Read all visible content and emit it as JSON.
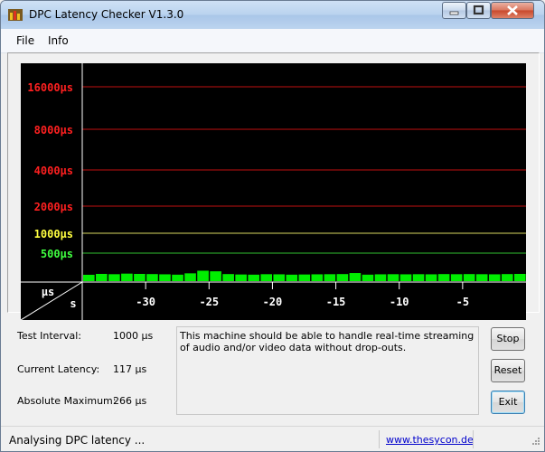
{
  "window": {
    "title": "DPC Latency Checker V1.3.0"
  },
  "menu": {
    "file": "File",
    "info": "Info"
  },
  "chart_data": {
    "type": "bar",
    "y_tick_labels": [
      {
        "label": "16000µs",
        "color": "#ff2020",
        "line_color": "#c01010"
      },
      {
        "label": "8000µs",
        "color": "#ff2020",
        "line_color": "#c01010"
      },
      {
        "label": "4000µs",
        "color": "#ff2020",
        "line_color": "#c01010"
      },
      {
        "label": "2000µs",
        "color": "#ff2020",
        "line_color": "#c01010"
      },
      {
        "label": "1000µs",
        "color": "#ffff40",
        "line_color": "#d8d860"
      },
      {
        "label": "500µs",
        "color": "#40ff40",
        "line_color": "#30c030"
      }
    ],
    "x_tick_labels": [
      "-30",
      "-25",
      "-20",
      "-15",
      "-10",
      "-5"
    ],
    "x_ticks": [
      -30,
      -25,
      -20,
      -15,
      -10,
      -5
    ],
    "xlim": [
      -35,
      0
    ],
    "corner_y_unit": "µs",
    "corner_x_unit": "s",
    "bar_color": "#00ee00",
    "y_scale": "log2",
    "values": [
      110,
      125,
      120,
      130,
      125,
      122,
      118,
      112,
      135,
      180,
      170,
      122,
      115,
      112,
      120,
      118,
      112,
      115,
      118,
      120,
      122,
      140,
      112,
      118,
      120,
      118,
      120,
      118,
      122,
      120,
      122,
      120,
      118,
      122,
      125
    ]
  },
  "stats": {
    "test_interval_label": "Test Interval:",
    "test_interval_value": "1000 µs",
    "current_latency_label": "Current Latency:",
    "current_latency_value": "117 µs",
    "absolute_max_label": "Absolute Maximum:",
    "absolute_max_value": "266 µs"
  },
  "message": "This machine should be able to handle real-time streaming of audio and/or video data without drop-outs.",
  "buttons": {
    "stop": "Stop",
    "reset": "Reset",
    "exit": "Exit"
  },
  "status": {
    "text": "Analysing DPC latency ...",
    "link": "www.thesycon.de"
  }
}
